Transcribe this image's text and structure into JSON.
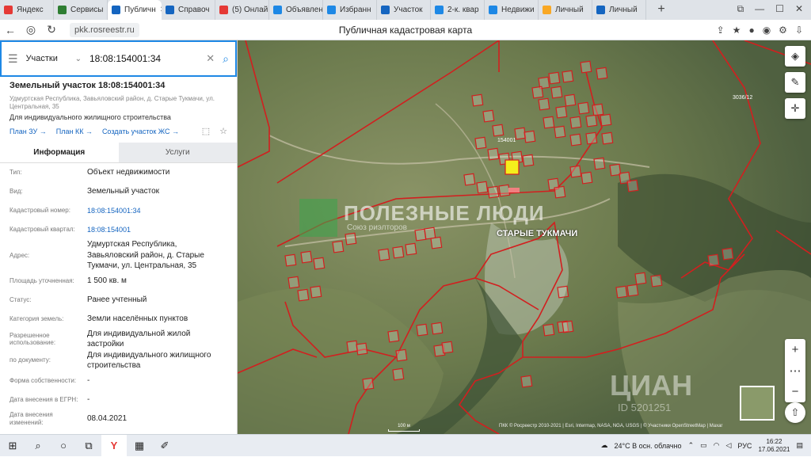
{
  "browser": {
    "tabs": [
      {
        "label": "Яндекс",
        "color": "#e53935",
        "active": false
      },
      {
        "label": "Сервисы",
        "color": "#2e7d32",
        "active": false
      },
      {
        "label": "Публичн",
        "color": "#1565c0",
        "active": true
      },
      {
        "label": "Справоч",
        "color": "#1565c0",
        "active": false
      },
      {
        "label": "(5) Онлай",
        "color": "#e53935",
        "active": false
      },
      {
        "label": "Объявлен",
        "color": "#1e88e5",
        "active": false
      },
      {
        "label": "Избранн",
        "color": "#1e88e5",
        "active": false
      },
      {
        "label": "Участок",
        "color": "#1565c0",
        "active": false
      },
      {
        "label": "2-к. квар",
        "color": "#1e88e5",
        "active": false
      },
      {
        "label": "Недвижи",
        "color": "#1e88e5",
        "active": false
      },
      {
        "label": "Личный",
        "color": "#f9a825",
        "active": false
      },
      {
        "label": "Личный",
        "color": "#1565c0",
        "active": false
      }
    ],
    "url": "pkk.rosreestr.ru",
    "page_title": "Публичная кадастровая карта"
  },
  "search": {
    "type": "Участки",
    "query": "18:08:154001:34"
  },
  "parcel": {
    "title": "Земельный участок 18:08:154001:34",
    "address": "Удмуртская Республика, Завьяловский район, д. Старые Тукмачи, ул. Центральная, 35",
    "purpose": "Для индивидуального жилищного строительства",
    "links": [
      "План ЗУ →",
      "План КК →",
      "Создать участок ЖС →"
    ]
  },
  "info_tabs": [
    "Информация",
    "Услуги"
  ],
  "fields": [
    {
      "k": "Тип:",
      "v": "Объект недвижимости",
      "link": false
    },
    {
      "k": "Вид:",
      "v": "Земельный участок",
      "link": false
    },
    {
      "k": "Кадастровый номер:",
      "v": "18:08:154001:34",
      "link": true
    },
    {
      "k": "Кадастровый квартал:",
      "v": "18:08:154001",
      "link": true
    },
    {
      "k": "Адрес:",
      "v": "Удмуртская Республика, Завьяловский район, д. Старые Тукмачи, ул. Центральная, 35",
      "link": false
    },
    {
      "k": "Площадь уточненная:",
      "v": "1 500 кв. м",
      "link": false
    },
    {
      "k": "Статус:",
      "v": "Ранее учтенный",
      "link": false
    },
    {
      "k": "Категория земель:",
      "v": "Земли населённых пунктов",
      "link": false
    },
    {
      "k": "Разрешенное использование:",
      "v": "Для индивидуальной жилой застройки",
      "link": false
    },
    {
      "k": "по документу:",
      "v": "Для индивидуального жилищного строительства",
      "link": false
    },
    {
      "k": "Форма собственности:",
      "v": "-",
      "link": false
    },
    {
      "k": "Дата внесения в ЕГРН:",
      "v": "-",
      "link": false
    },
    {
      "k": "Дата внесения изменений:",
      "v": "08.04.2021",
      "link": false
    }
  ],
  "map": {
    "village_label": "СТАРЫЕ ТУКМАЧИ",
    "quarter_label": "3036/12",
    "parcel_label": "154001",
    "watermark_main": "ПОЛЕЗНЫЕ ЛЮДИ",
    "watermark_sub": "Союз риэлторов",
    "cian": "ЦИАН",
    "cian_id": "ID 5201251",
    "scale": "100 м",
    "attribution": "ПКК © Росреестр 2010-2021 | Esri, Intermap, NASA, NGA, USGS | © Участники OpenStreetMap | Maxar"
  },
  "taskbar": {
    "weather": "24°C  В осн. облачно",
    "lang": "РУС",
    "time": "16:22",
    "date": "17.06.2021"
  }
}
